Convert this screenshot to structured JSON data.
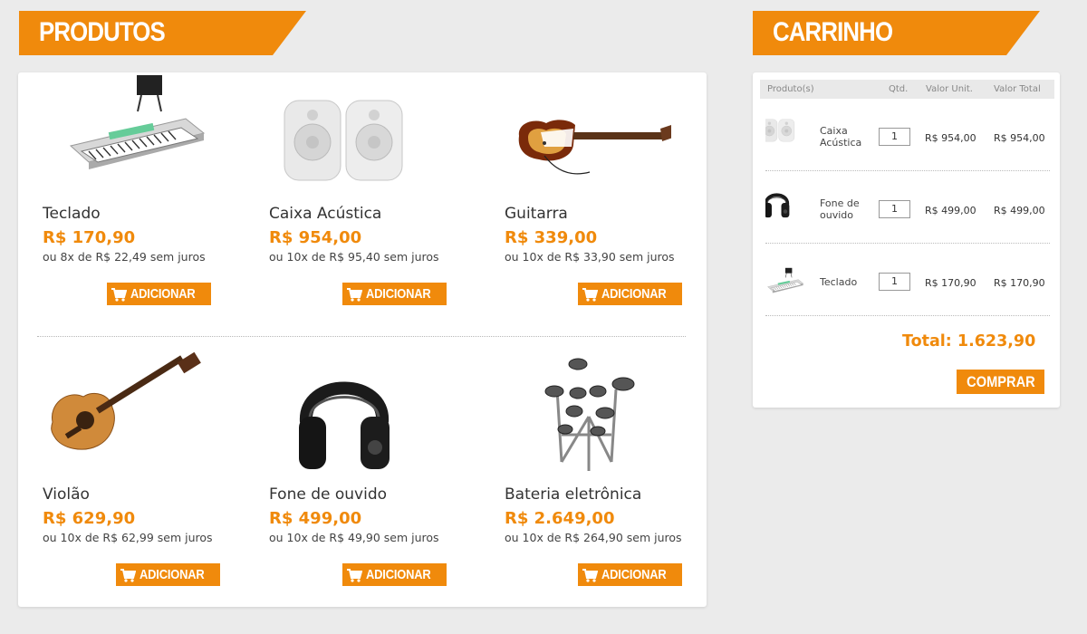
{
  "colors": {
    "accent": "#f08a0c",
    "background": "#ebebeb",
    "panel": "#ffffff"
  },
  "products_section": {
    "title": "PRODUTOS",
    "items": [
      {
        "name": "Teclado",
        "price": "R$ 170,90",
        "installments": "ou 8x de R$ 22,49 sem juros",
        "button": "ADICIONAR",
        "icon": "keyboard-image"
      },
      {
        "name": "Caixa Acústica",
        "price": "R$ 954,00",
        "installments": "ou 10x de R$ 95,40 sem juros",
        "button": "ADICIONAR",
        "icon": "speakers-image"
      },
      {
        "name": "Guitarra",
        "price": "R$ 339,00",
        "installments": "ou 10x de R$ 33,90 sem juros",
        "button": "ADICIONAR",
        "icon": "electric-guitar-image"
      },
      {
        "name": "Violão",
        "price": "R$ 629,90",
        "installments": "ou 10x de R$ 62,99 sem juros",
        "button": "ADICIONAR",
        "icon": "acoustic-guitar-image"
      },
      {
        "name": "Fone de ouvido",
        "price": "R$ 499,00",
        "installments": "ou 10x de R$ 49,90 sem juros",
        "button": "ADICIONAR",
        "icon": "headphones-image"
      },
      {
        "name": "Bateria eletrônica",
        "price": "R$ 2.649,00",
        "installments": "ou 10x de R$ 264,90 sem juros",
        "button": "ADICIONAR",
        "icon": "electronic-drums-image"
      }
    ]
  },
  "cart": {
    "title": "CARRINHO",
    "columns": {
      "product": "Produto(s)",
      "qty": "Qtd.",
      "unit": "Valor  Unit.",
      "total": "Valor  Total"
    },
    "items": [
      {
        "name": "Caixa Acústica",
        "qty": "1",
        "unit_price": "R$ 954,00",
        "total_price": "R$ 954,00"
      },
      {
        "name": "Fone de ouvido",
        "qty": "1",
        "unit_price": "R$ 499,00",
        "total_price": "R$ 499,00"
      },
      {
        "name": "Teclado",
        "qty": "1",
        "unit_price": "R$ 170,90",
        "total_price": "R$ 170,90"
      }
    ],
    "total": "Total: 1.623,90",
    "buy_button": "COMPRAR"
  }
}
